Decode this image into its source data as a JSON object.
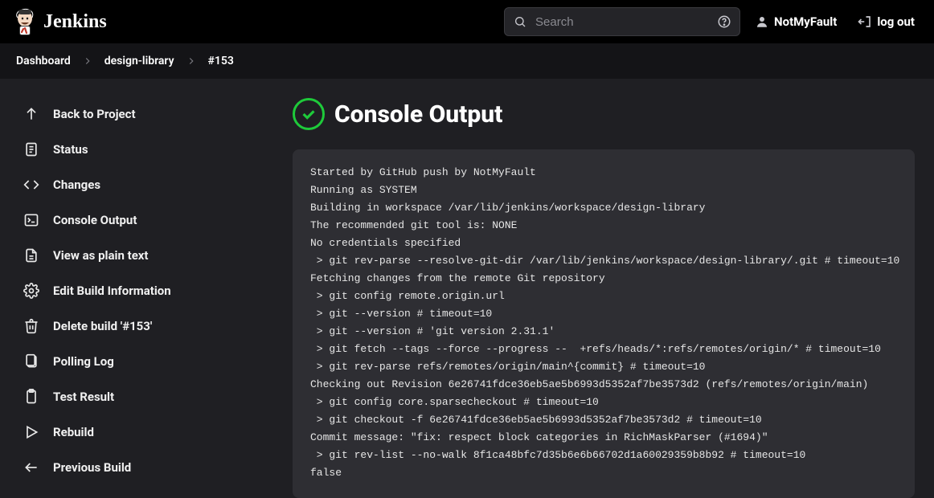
{
  "header": {
    "app_name": "Jenkins",
    "search_placeholder": "Search",
    "user_name": "NotMyFault",
    "logout_label": "log out"
  },
  "breadcrumbs": [
    {
      "label": "Dashboard"
    },
    {
      "label": "design-library"
    },
    {
      "label": "#153"
    }
  ],
  "sidebar": {
    "items": [
      {
        "id": "back-to-project",
        "label": "Back to Project"
      },
      {
        "id": "status",
        "label": "Status"
      },
      {
        "id": "changes",
        "label": "Changes"
      },
      {
        "id": "console-output",
        "label": "Console Output"
      },
      {
        "id": "view-plain",
        "label": "View as plain text"
      },
      {
        "id": "edit-build",
        "label": "Edit Build Information"
      },
      {
        "id": "delete-build",
        "label": "Delete build '#153'"
      },
      {
        "id": "polling-log",
        "label": "Polling Log"
      },
      {
        "id": "test-result",
        "label": "Test Result"
      },
      {
        "id": "rebuild",
        "label": "Rebuild"
      },
      {
        "id": "previous-build",
        "label": "Previous Build"
      }
    ]
  },
  "page": {
    "title": "Console Output",
    "status": "success"
  },
  "console_lines": [
    "Started by GitHub push by NotMyFault",
    "Running as SYSTEM",
    "Building in workspace /var/lib/jenkins/workspace/design-library",
    "The recommended git tool is: NONE",
    "No credentials specified",
    " > git rev-parse --resolve-git-dir /var/lib/jenkins/workspace/design-library/.git # timeout=10",
    "Fetching changes from the remote Git repository",
    " > git config remote.origin.url",
    " > git --version # timeout=10",
    " > git --version # 'git version 2.31.1'",
    " > git fetch --tags --force --progress --  +refs/heads/*:refs/remotes/origin/* # timeout=10",
    " > git rev-parse refs/remotes/origin/main^{commit} # timeout=10",
    "Checking out Revision 6e26741fdce36eb5ae5b6993d5352af7be3573d2 (refs/remotes/origin/main)",
    " > git config core.sparsecheckout # timeout=10",
    " > git checkout -f 6e26741fdce36eb5ae5b6993d5352af7be3573d2 # timeout=10",
    "Commit message: \"fix: respect block categories in RichMaskParser (#1694)\"",
    " > git rev-list --no-walk 8f1ca48bfc7d35b6e6b66702d1a60029359b8b92 # timeout=10",
    "false"
  ]
}
